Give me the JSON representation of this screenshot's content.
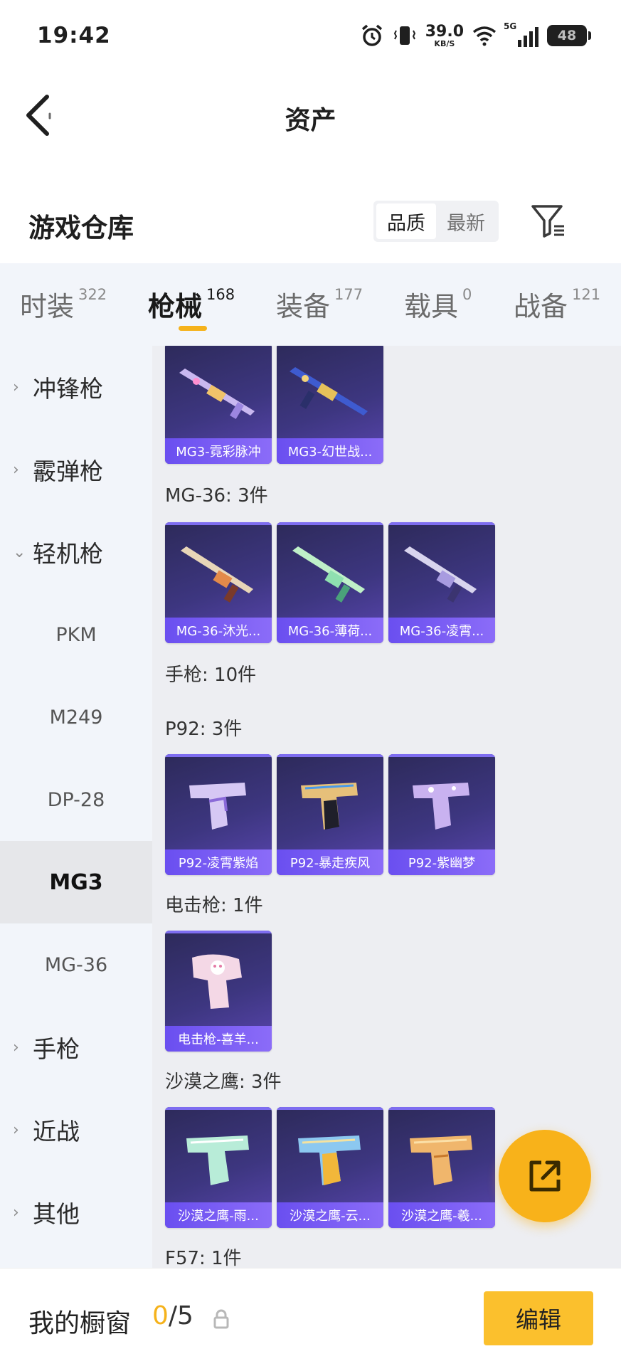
{
  "status_bar": {
    "time": "19:42",
    "net_speed": "39.0",
    "net_unit": "KB/S",
    "network": "5G",
    "battery": "48"
  },
  "header": {
    "title": "资产"
  },
  "warehouse": {
    "title": "游戏仓库",
    "sort_options": [
      {
        "label": "品质",
        "active": true
      },
      {
        "label": "最新",
        "active": false
      }
    ]
  },
  "category_tabs": [
    {
      "label": "时装",
      "count": "322",
      "active": false
    },
    {
      "label": "枪械",
      "count": "168",
      "active": true
    },
    {
      "label": "装备",
      "count": "177",
      "active": false
    },
    {
      "label": "载具",
      "count": "0",
      "active": false
    },
    {
      "label": "战备",
      "count": "121",
      "active": false
    }
  ],
  "sidebar": {
    "groups": [
      {
        "label": "冲锋枪",
        "expanded": false
      },
      {
        "label": "霰弹枪",
        "expanded": false
      },
      {
        "label": "轻机枪",
        "expanded": true
      },
      {
        "label": "手枪",
        "expanded": false
      },
      {
        "label": "近战",
        "expanded": false
      },
      {
        "label": "其他",
        "expanded": false
      }
    ],
    "subitems": [
      {
        "label": "PKM",
        "active": false
      },
      {
        "label": "M249",
        "active": false
      },
      {
        "label": "DP-28",
        "active": false
      },
      {
        "label": "MG3",
        "active": true
      },
      {
        "label": "MG-36",
        "active": false
      }
    ]
  },
  "content": {
    "sections": [
      {
        "title": "",
        "items": [
          "MG3-霓彩脉冲",
          "MG3-幻世战..."
        ]
      },
      {
        "title": "MG-36: 3件",
        "items": [
          "MG-36-沐光...",
          "MG-36-薄荷...",
          "MG-36-凌霄..."
        ]
      },
      {
        "title": "手枪: 10件",
        "items": []
      },
      {
        "title": "P92: 3件",
        "items": [
          "P92-凌霄紫焰",
          "P92-暴走疾风",
          "P92-紫幽梦"
        ]
      },
      {
        "title": "电击枪: 1件",
        "items": [
          "电击枪-喜羊..."
        ]
      },
      {
        "title": "沙漠之鹰: 3件",
        "items": [
          "沙漠之鹰-雨...",
          "沙漠之鹰-云...",
          "沙漠之鹰-羲..."
        ]
      },
      {
        "title": "F57: 1件",
        "items": []
      }
    ]
  },
  "bottom_bar": {
    "label": "我的橱窗",
    "current": "0",
    "separator": "/",
    "total": "5",
    "edit_label": "编辑"
  },
  "colors": {
    "accent": "#f5b21b",
    "card_label": "#7b5ef5",
    "card_bg": "#3d3680",
    "sidebar_bg": "#f2f5fa",
    "content_bg": "#edeef2"
  }
}
